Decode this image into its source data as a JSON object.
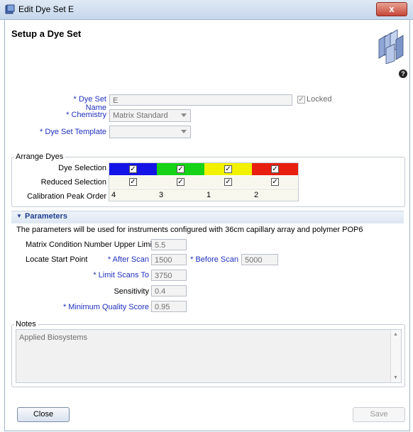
{
  "window": {
    "title": "Edit Dye Set E",
    "close_label": "x"
  },
  "header": {
    "title": "Setup a Dye Set",
    "help_label": "?"
  },
  "dye_set_name": {
    "label": "Dye Set Name",
    "value": "E",
    "locked_label": "Locked",
    "locked": true
  },
  "chemistry": {
    "label": "Chemistry",
    "value": "Matrix Standard"
  },
  "dye_set_template": {
    "label": "Dye Set Template",
    "value": ""
  },
  "arrange_dyes": {
    "legend": "Arrange Dyes",
    "dye_selection_label": "Dye Selection",
    "reduced_selection_label": "Reduced Selection",
    "calibration_peak_order_label": "Calibration Peak Order",
    "dyes": [
      {
        "color": "#1414e6",
        "selected": true,
        "reduced": true,
        "peak_order": "4"
      },
      {
        "color": "#17d317",
        "selected": true,
        "reduced": true,
        "peak_order": "3"
      },
      {
        "color": "#f2f200",
        "selected": true,
        "reduced": true,
        "peak_order": "1"
      },
      {
        "color": "#e81f10",
        "selected": true,
        "reduced": true,
        "peak_order": "2"
      }
    ]
  },
  "parameters": {
    "header": "Parameters",
    "description": "The parameters will be used for instruments configured with 36cm capillary array and polymer POP6",
    "matrix_condition": {
      "label": "Matrix Condition Number Upper Limit",
      "value": "5.5"
    },
    "locate_start_point_label": "Locate Start Point",
    "after_scan": {
      "label": "After Scan",
      "value": "1500"
    },
    "before_scan": {
      "label": "Before Scan",
      "value": "5000"
    },
    "limit_scans_to": {
      "label": "Limit Scans To",
      "value": "3750"
    },
    "sensitivity": {
      "label": "Sensitivity",
      "value": "0.4"
    },
    "minimum_quality_score": {
      "label": "Minimum Quality Score",
      "value": "0.95"
    }
  },
  "notes": {
    "legend": "Notes",
    "value": "Applied Biosystems"
  },
  "buttons": {
    "close": "Close",
    "save": "Save"
  },
  "required_marker": "*"
}
